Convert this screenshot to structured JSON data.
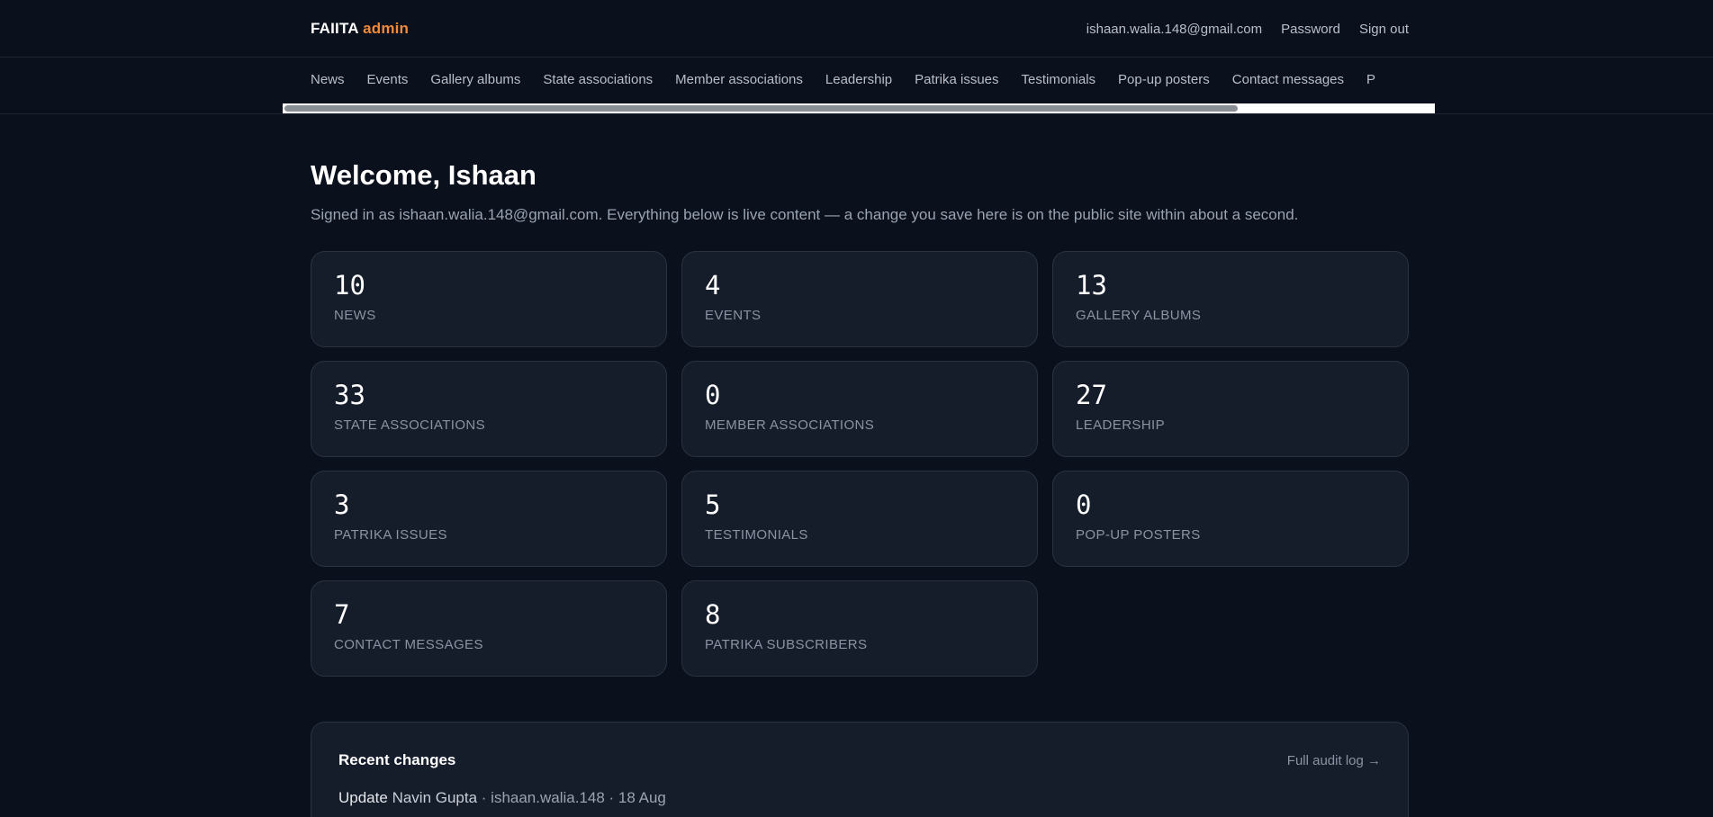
{
  "brand": {
    "name": "FAIITA",
    "suffix": "admin"
  },
  "header": {
    "user_email": "ishaan.walia.148@gmail.com",
    "password_link": "Password",
    "signout_link": "Sign out"
  },
  "nav": {
    "items": [
      "News",
      "Events",
      "Gallery albums",
      "State associations",
      "Member associations",
      "Leadership",
      "Patrika issues",
      "Testimonials",
      "Pop-up posters",
      "Contact messages",
      "P"
    ],
    "scroll_position": 0.83
  },
  "welcome": {
    "title": "Welcome, Ishaan",
    "subtitle": "Signed in as ishaan.walia.148@gmail.com. Everything below is live content — a change you save here is on the public site within about a second."
  },
  "stats": [
    {
      "count": "10",
      "label": "NEWS"
    },
    {
      "count": "4",
      "label": "EVENTS"
    },
    {
      "count": "13",
      "label": "GALLERY ALBUMS"
    },
    {
      "count": "33",
      "label": "STATE ASSOCIATIONS"
    },
    {
      "count": "0",
      "label": "MEMBER ASSOCIATIONS"
    },
    {
      "count": "27",
      "label": "LEADERSHIP"
    },
    {
      "count": "3",
      "label": "PATRIKA ISSUES"
    },
    {
      "count": "5",
      "label": "TESTIMONIALS"
    },
    {
      "count": "0",
      "label": "POP-UP POSTERS"
    },
    {
      "count": "7",
      "label": "CONTACT MESSAGES"
    },
    {
      "count": "8",
      "label": "PATRIKA SUBSCRIBERS"
    }
  ],
  "recent": {
    "title": "Recent changes",
    "audit_link": "Full audit log →",
    "items": [
      {
        "action": "Update",
        "target": "Navin Gupta",
        "meta": " · ishaan.walia.148 · 18 Aug"
      }
    ]
  },
  "colors": {
    "background": "#0a101c",
    "card": "#161d2a",
    "accent": "#f08a3c"
  }
}
